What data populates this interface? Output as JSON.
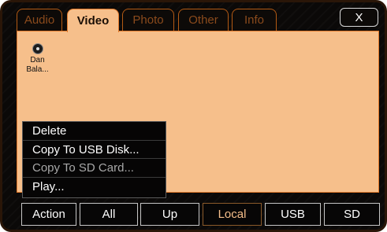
{
  "top_tabs": [
    {
      "label": "Audio",
      "active": false
    },
    {
      "label": "Video",
      "active": true
    },
    {
      "label": "Photo",
      "active": false
    },
    {
      "label": "Other",
      "active": false
    },
    {
      "label": "Info",
      "active": false
    }
  ],
  "close_label": "X",
  "file": {
    "label": "Dan\nBala...",
    "icon": "video-file-icon"
  },
  "context_menu": [
    {
      "label": "Delete",
      "enabled": true
    },
    {
      "label": "Copy To USB Disk...",
      "enabled": true
    },
    {
      "label": "Copy To SD Card...",
      "enabled": false
    },
    {
      "label": "Play...",
      "enabled": true
    }
  ],
  "bottom_bar": [
    {
      "label": "Action",
      "active": false
    },
    {
      "label": "All",
      "active": false
    },
    {
      "label": "Up",
      "active": false
    },
    {
      "label": "Local",
      "active": true
    },
    {
      "label": "USB",
      "active": false
    },
    {
      "label": "SD",
      "active": false
    }
  ],
  "colors": {
    "accent": "#f6bf8b",
    "border": "#e0782a",
    "background": "#0b0908"
  }
}
